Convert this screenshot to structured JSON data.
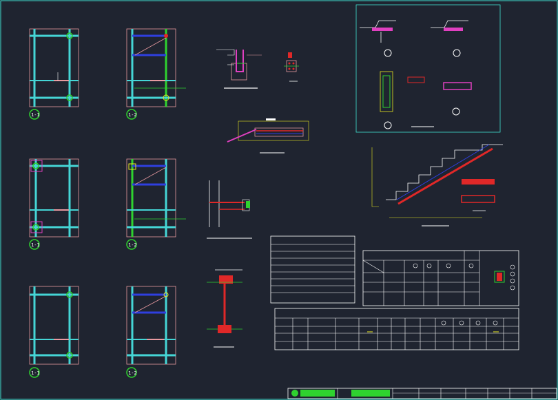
{
  "section_labels": [
    "1-1",
    "1-2",
    "1-1",
    "1-2",
    "1-1",
    "1-2"
  ],
  "colors": {
    "background": "#1f2430",
    "frame": "#40e0d0",
    "rebar_cyan": "#45d6d6",
    "rebar_green": "#2fd22f",
    "rebar_blue": "#2f3fe0",
    "rebar_red": "#e02828",
    "magenta": "#e040c0",
    "yellow": "#e8e820",
    "pink": "#e89aa0",
    "white": "#ffffff"
  }
}
